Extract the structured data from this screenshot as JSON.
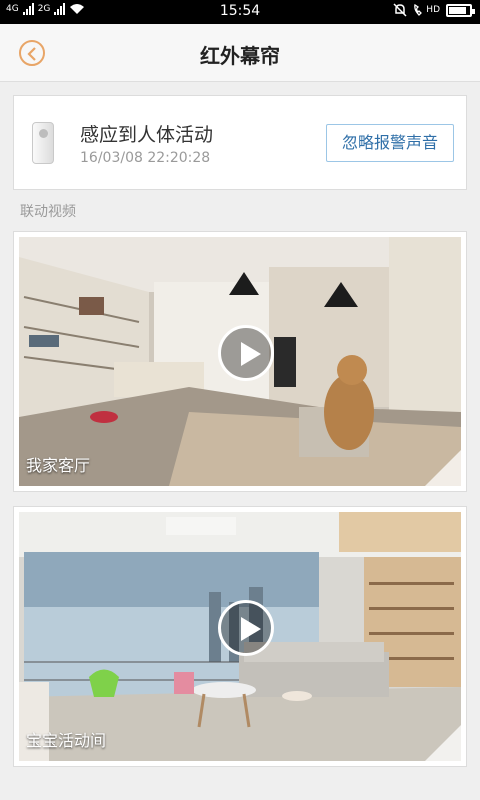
{
  "status_bar": {
    "network_left": "4G",
    "network_right": "2G",
    "time": "15:54",
    "hd_label": "HD",
    "battery_level": 0.85,
    "icons": [
      "signal-icon",
      "wifi-icon",
      "mute-icon",
      "volte-icon",
      "battery-icon"
    ]
  },
  "header": {
    "title": "红外幕帘",
    "back_icon": "chevron-left-icon",
    "accent": "#e8a567"
  },
  "alert": {
    "title": "感应到人体活动",
    "timestamp": "16/03/08 22:20:28",
    "ignore_button": "忽略报警声音",
    "device_icon": "infrared-sensor-icon"
  },
  "section_label": "联动视频",
  "videos": [
    {
      "label": "我家客厅"
    },
    {
      "label": "宝宝活动间"
    }
  ]
}
